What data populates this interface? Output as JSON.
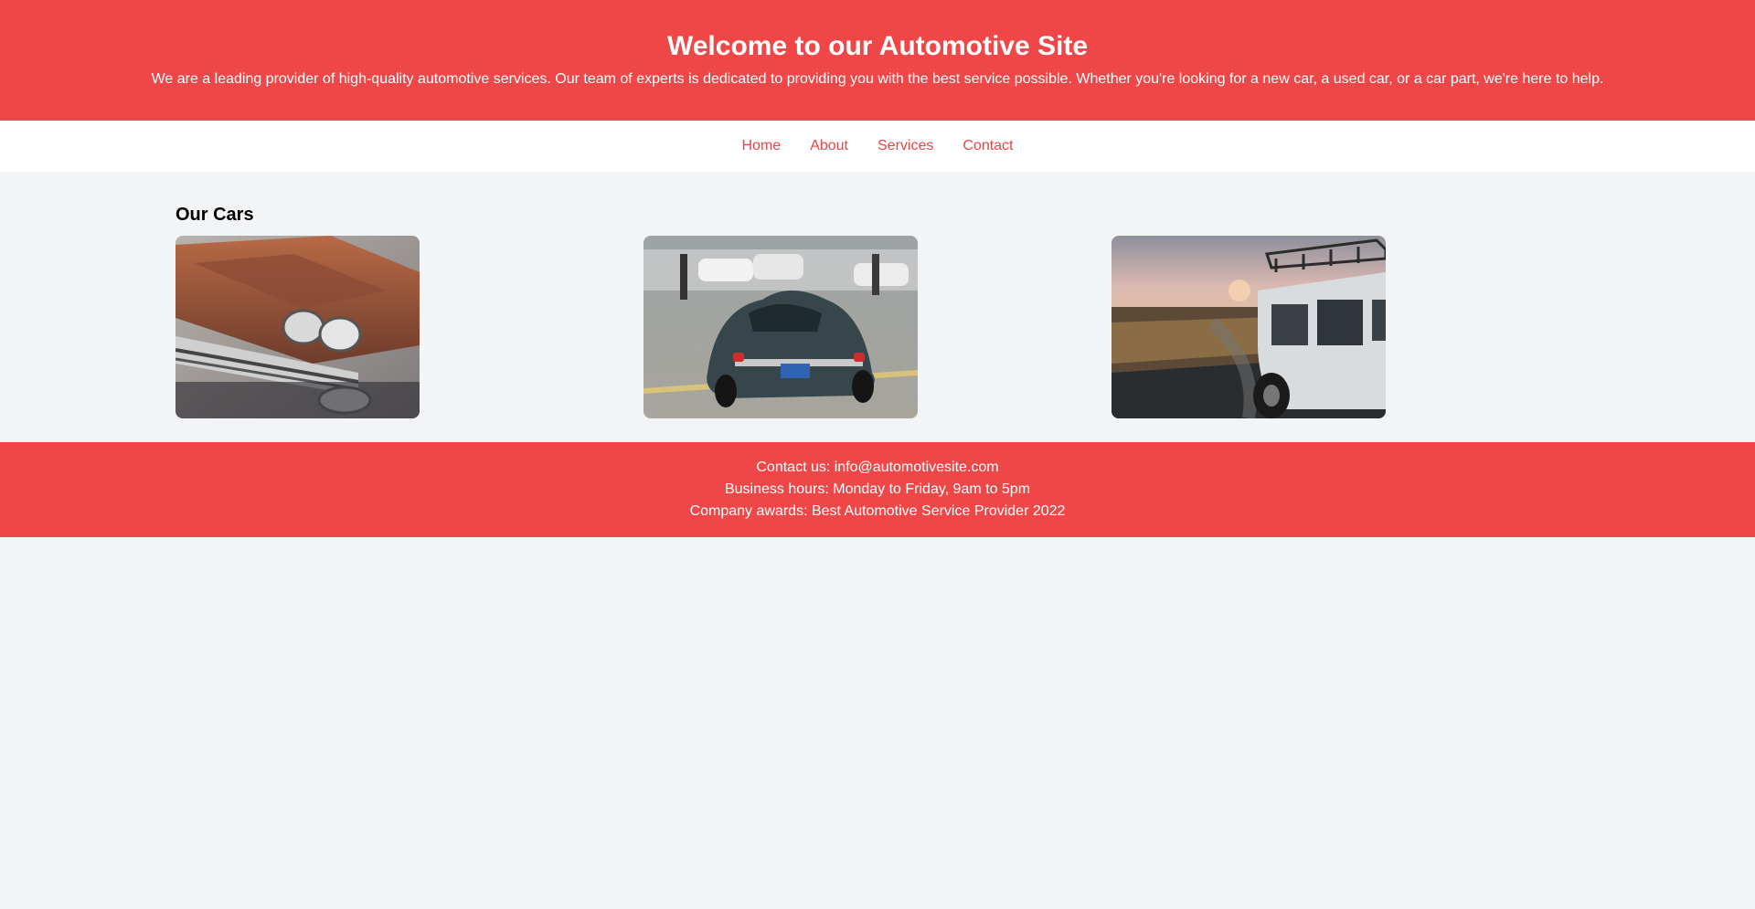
{
  "header": {
    "title": "Welcome to our Automotive Site",
    "description": "We are a leading provider of high-quality automotive services. Our team of experts is dedicated to providing you with the best service possible. Whether you're looking for a new car, a used car, or a car part, we're here to help."
  },
  "nav": {
    "items": [
      {
        "label": "Home"
      },
      {
        "label": "About"
      },
      {
        "label": "Services"
      },
      {
        "label": "Contact"
      }
    ]
  },
  "main": {
    "section_title": "Our Cars",
    "cars": [
      {
        "image": "rusty-vintage-car-photo"
      },
      {
        "image": "classic-sports-car-photo"
      },
      {
        "image": "white-offroad-suv-photo"
      }
    ]
  },
  "footer": {
    "contact": "Contact us: info@automotivesite.com",
    "hours": "Business hours: Monday to Friday, 9am to 5pm",
    "awards": "Company awards: Best Automotive Service Provider 2022"
  },
  "colors": {
    "brand_red": "#ef4747",
    "link_red": "#ef4444",
    "page_background": "#f3f4f6"
  }
}
